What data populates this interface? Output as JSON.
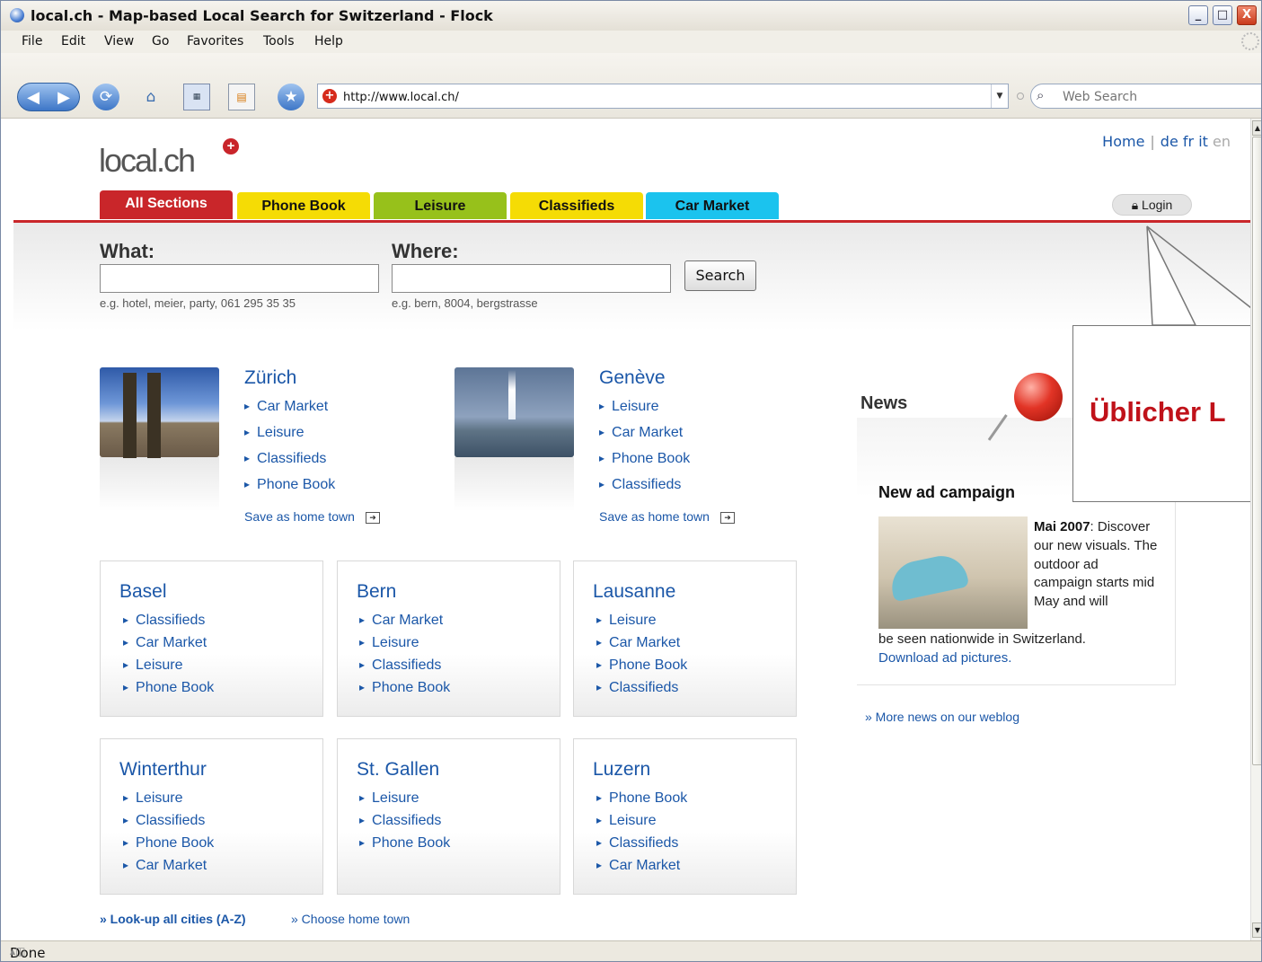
{
  "window": {
    "title": "local.ch - Map-based Local Search for Switzerland - Flock",
    "buttons": {
      "minimize": "_",
      "maximize": "□",
      "close": "X"
    }
  },
  "menu": [
    "File",
    "Edit",
    "View",
    "Go",
    "Favorites",
    "Tools",
    "Help"
  ],
  "toolbar": {
    "url": "http://www.local.ch/",
    "search_placeholder": "Web Search",
    "icons": [
      "back-icon",
      "forward-icon",
      "reload-icon",
      "home-icon",
      "photo-uploader-icon",
      "blog-editor-icon",
      "star-icon"
    ]
  },
  "site": {
    "logo": "local.ch",
    "logo_plus": "+",
    "toplinks": {
      "home": "Home",
      "de": "de",
      "fr": "fr",
      "it": "it",
      "en": "en",
      "sep": "|"
    },
    "tabs": [
      "All Sections",
      "Phone Book",
      "Leisure",
      "Classifieds",
      "Car Market"
    ],
    "login": "Login",
    "what_label": "What:",
    "where_label": "Where:",
    "what_hint": "e.g. hotel, meier, party, 061 295 35 35",
    "where_hint": "e.g. bern, 8004, bergstrasse",
    "search_button": "Search"
  },
  "featured": [
    {
      "name": "Zürich",
      "links": [
        "Car Market",
        "Leisure",
        "Classifieds",
        "Phone Book"
      ],
      "save": "Save as home town"
    },
    {
      "name": "Genève",
      "links": [
        "Leisure",
        "Car Market",
        "Phone Book",
        "Classifieds"
      ],
      "save": "Save as home town"
    }
  ],
  "cities": [
    {
      "name": "Basel",
      "links": [
        "Classifieds",
        "Car Market",
        "Leisure",
        "Phone Book"
      ]
    },
    {
      "name": "Bern",
      "links": [
        "Car Market",
        "Leisure",
        "Classifieds",
        "Phone Book"
      ]
    },
    {
      "name": "Lausanne",
      "links": [
        "Leisure",
        "Car Market",
        "Phone Book",
        "Classifieds"
      ]
    },
    {
      "name": "Winterthur",
      "links": [
        "Leisure",
        "Classifieds",
        "Phone Book",
        "Car Market"
      ]
    },
    {
      "name": "St. Gallen",
      "links": [
        "Leisure",
        "Classifieds",
        "Phone Book"
      ]
    },
    {
      "name": "Luzern",
      "links": [
        "Phone Book",
        "Leisure",
        "Classifieds",
        "Car Market"
      ]
    }
  ],
  "news": {
    "title": "News",
    "headline": "New ad campaign",
    "date": "Mai 2007",
    "text_a": "Discover our new visuals. The outdoor ad campaign starts mid May and will",
    "text_b": "be seen nationwide in Switzerland.",
    "download": "Download ad pictures.",
    "more": "» More news on our weblog"
  },
  "bottom": {
    "lookup": "» Look-up all cities (A-Z)",
    "choose": "» Choose home town"
  },
  "callout": "Üblicher L",
  "status": "Done"
}
